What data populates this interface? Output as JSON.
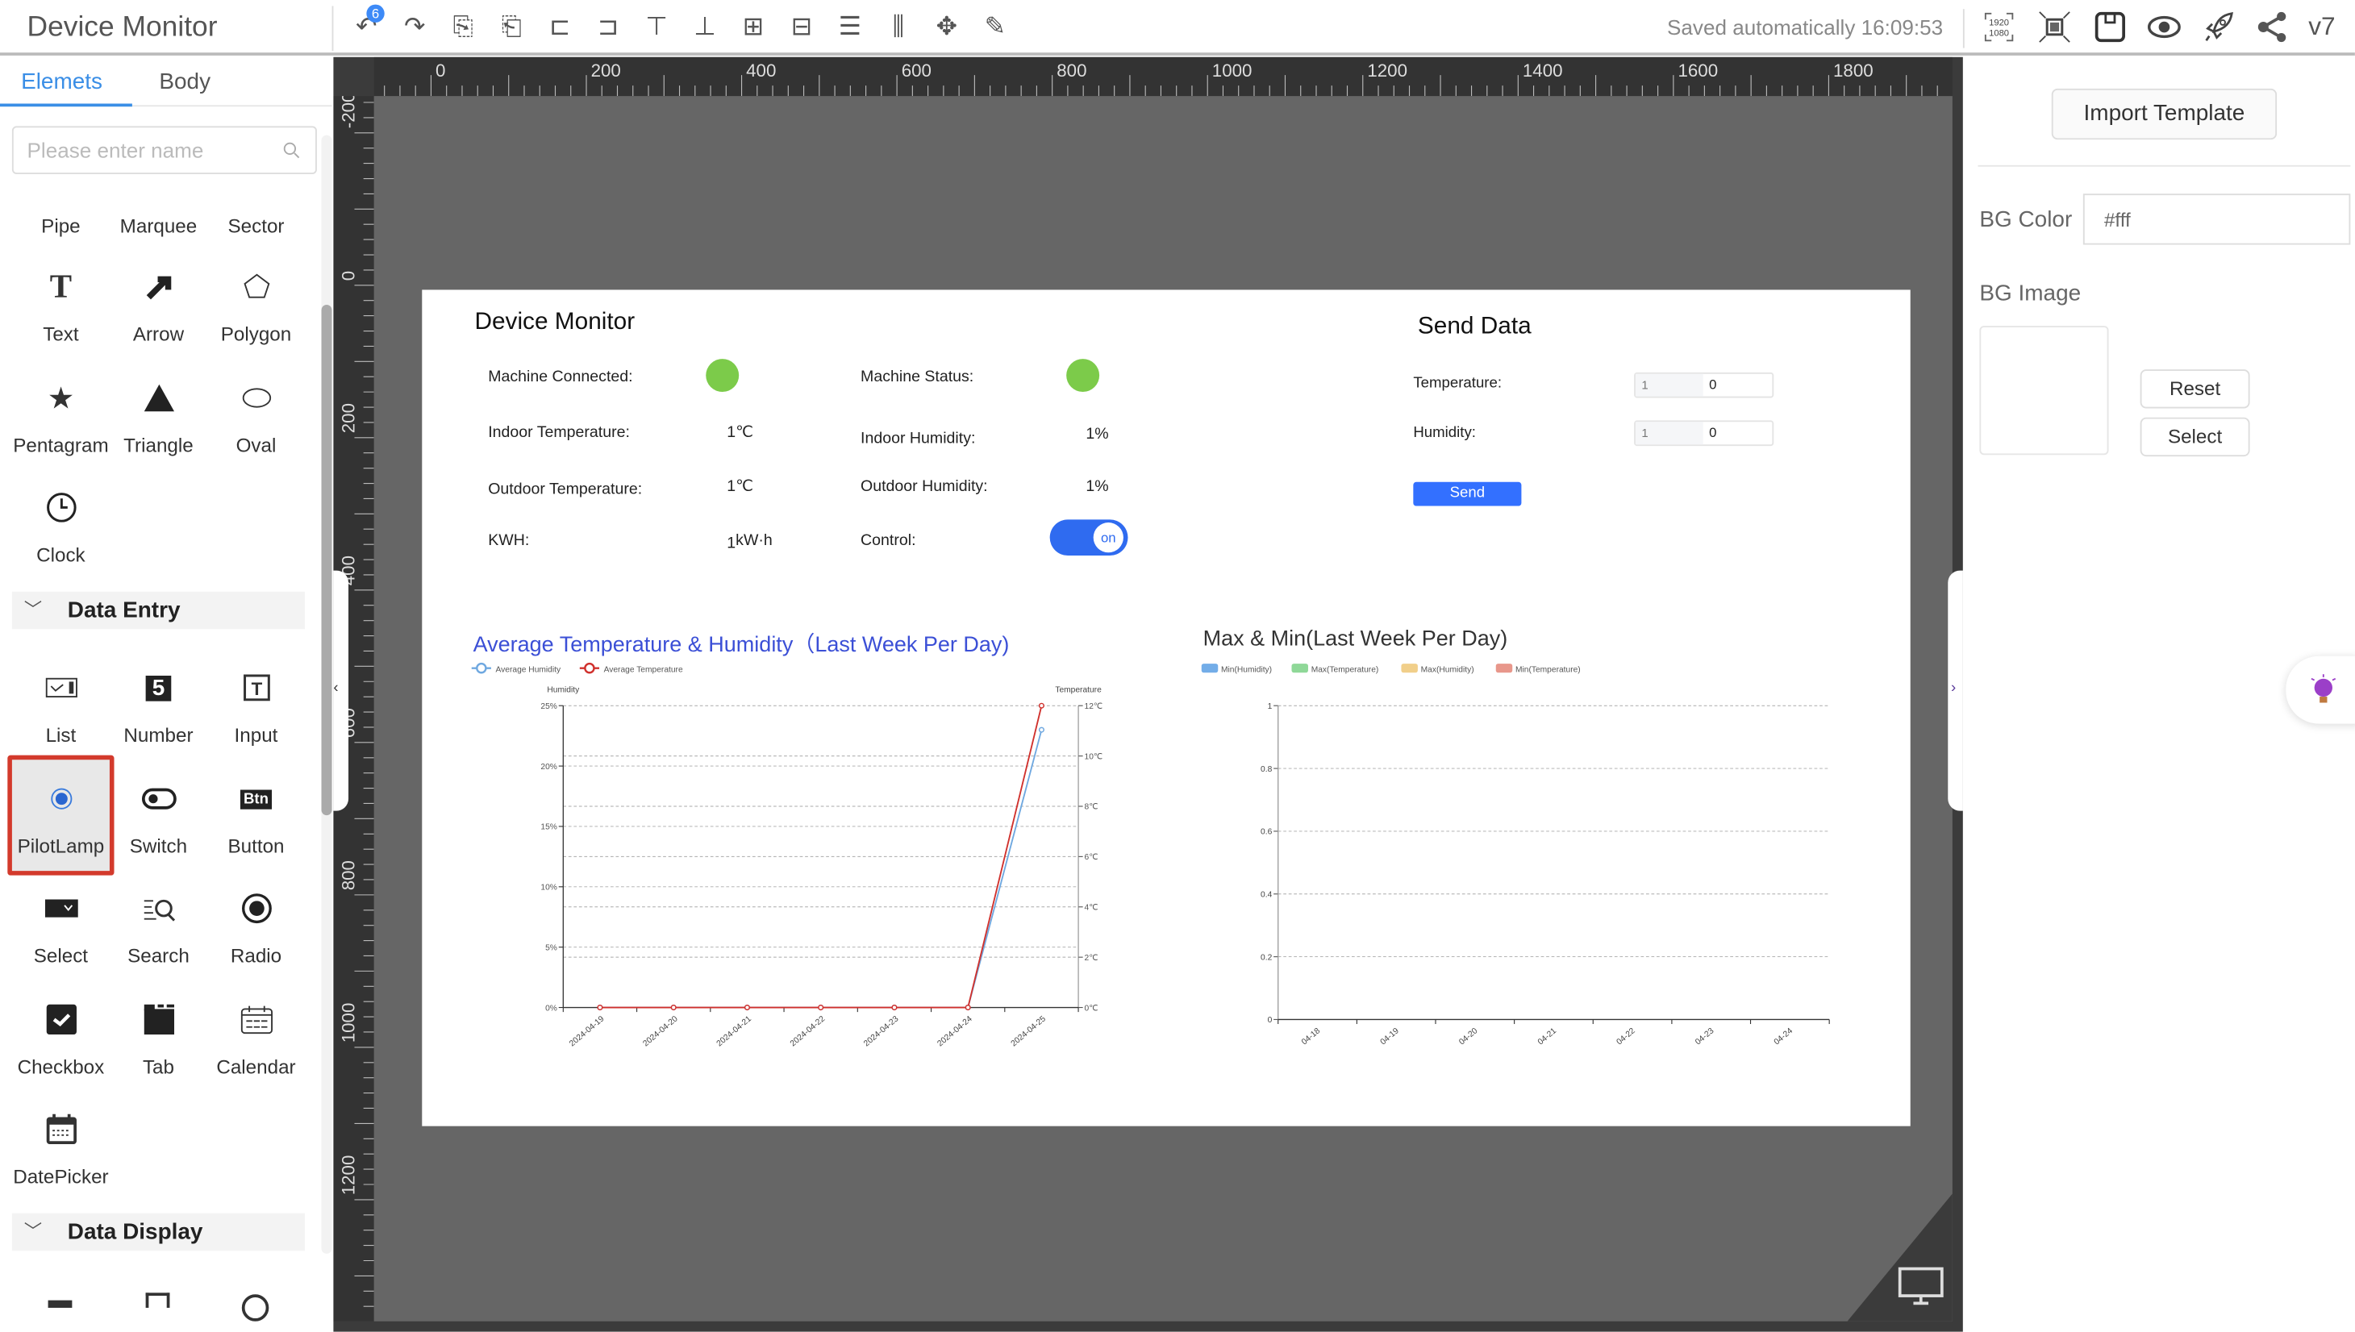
{
  "header": {
    "title": "Device Monitor",
    "undo_badge": "6",
    "saved_status": "Saved automatically 16:09:53",
    "resolution_icon": [
      "1920",
      "1080"
    ],
    "version": "v7",
    "toolbar_icons": [
      "undo-icon",
      "redo-icon",
      "copy-icon",
      "paste-icon",
      "align-left-icon",
      "align-right-icon",
      "align-top-icon",
      "align-bottom-icon",
      "align-center-horizontal-icon",
      "align-center-vertical-icon",
      "distribute-vertical-icon",
      "distribute-horizontal-icon",
      "move-icon",
      "edit-icon"
    ],
    "right_icons": [
      "resolution-icon",
      "fit-screen-icon",
      "save-icon",
      "preview-icon",
      "publish-rocket-icon",
      "share-icon"
    ]
  },
  "sidebar": {
    "tabs": [
      {
        "label": "Elemets",
        "active": true
      },
      {
        "label": "Body",
        "active": false
      }
    ],
    "search_placeholder": "Please enter name",
    "basic_items": [
      {
        "label": "Pipe",
        "icon": ""
      },
      {
        "label": "Marquee",
        "icon": ""
      },
      {
        "label": "Sector",
        "icon": ""
      },
      {
        "label": "Text",
        "icon": "text-icon"
      },
      {
        "label": "Arrow",
        "icon": "arrow-icon"
      },
      {
        "label": "Polygon",
        "icon": "polygon-icon"
      },
      {
        "label": "Pentagram",
        "icon": "star-icon"
      },
      {
        "label": "Triangle",
        "icon": "triangle-icon"
      },
      {
        "label": "Oval",
        "icon": "oval-icon"
      },
      {
        "label": "Clock",
        "icon": "clock-icon"
      }
    ],
    "groups": [
      {
        "label": "Data Entry",
        "items": [
          {
            "label": "List",
            "icon": "list-icon"
          },
          {
            "label": "Number",
            "icon": "number-icon",
            "glyph": "5"
          },
          {
            "label": "Input",
            "icon": "input-icon"
          },
          {
            "label": "PilotLamp",
            "icon": "pilot-lamp-icon",
            "selected": true
          },
          {
            "label": "Switch",
            "icon": "switch-icon"
          },
          {
            "label": "Button",
            "icon": "button-icon",
            "glyph": "Btn"
          },
          {
            "label": "Select",
            "icon": "select-icon"
          },
          {
            "label": "Search",
            "icon": "search-list-icon"
          },
          {
            "label": "Radio",
            "icon": "radio-icon"
          },
          {
            "label": "Checkbox",
            "icon": "checkbox-icon"
          },
          {
            "label": "Tab",
            "icon": "tab-icon"
          },
          {
            "label": "Calendar",
            "icon": "calendar-icon"
          },
          {
            "label": "DatePicker",
            "icon": "datepicker-icon"
          }
        ]
      },
      {
        "label": "Data Display",
        "items": []
      }
    ]
  },
  "rulers": {
    "horizontal": [
      "0",
      "200",
      "400",
      "600",
      "800",
      "1000",
      "1200",
      "1400",
      "1600",
      "1800"
    ],
    "vertical": [
      "-200",
      "0",
      "200",
      "400",
      "600",
      "800",
      "1000",
      "1200"
    ]
  },
  "board": {
    "monitor": {
      "title": "Device Monitor",
      "machine_connected_label": "Machine Connected:",
      "machine_status_label": "Machine Status:",
      "lamp_color": "#7ccb4a",
      "indoor_temp_label": "Indoor Temperature:",
      "indoor_temp_value": "1",
      "temp_unit": "℃",
      "indoor_humidity_label": "Indoor Humidity:",
      "indoor_humidity_value": "1%",
      "outdoor_temp_label": "Outdoor Temperature:",
      "outdoor_temp_value": "1℃",
      "outdoor_humidity_label": "Outdoor Humidity:",
      "outdoor_humidity_value": "1%",
      "kwh_label": "KWH:",
      "kwh_value": "1",
      "kwh_unit": "kW·h",
      "control_label": "Control:",
      "control_state": "on"
    },
    "send": {
      "title": "Send Data",
      "temperature_label": "Temperature:",
      "temperature_prefix": "1",
      "temperature_value": "0",
      "humidity_label": "Humidity:",
      "humidity_prefix": "1",
      "humidity_value": "0",
      "send_label": "Send",
      "accent": "#3370ff"
    }
  },
  "chart_data": [
    {
      "type": "line",
      "title": "Average Temperature & Humidity（Last Week Per Day)",
      "title_color": "#3b4fd6",
      "categories": [
        "2024-04-19",
        "2024-04-20",
        "2024-04-21",
        "2024-04-22",
        "2024-04-23",
        "2024-04-24",
        "2024-04-25"
      ],
      "series": [
        {
          "name": "Average Humidity",
          "axis": "left",
          "color": "#6fa8e0",
          "values": [
            0,
            0,
            0,
            0,
            0,
            0,
            23
          ]
        },
        {
          "name": "Average Temperature",
          "axis": "right",
          "color": "#d0312d",
          "values": [
            0,
            0,
            0,
            0,
            0,
            0,
            12
          ]
        }
      ],
      "ylabel_left": "Humidity",
      "ylabel_right": "Temperature",
      "ylim_left": [
        0,
        25
      ],
      "yticks_left": [
        "0%",
        "5%",
        "10%",
        "15%",
        "20%",
        "25%"
      ],
      "ylim_right": [
        0,
        12
      ],
      "yticks_right": [
        "0℃",
        "2℃",
        "4℃",
        "6℃",
        "8℃",
        "10℃",
        "12℃"
      ],
      "grid": true,
      "legend": "top-left"
    },
    {
      "type": "bar",
      "title": "Max & Min(Last Week Per Day)",
      "categories": [
        "04-18",
        "04-19",
        "04-20",
        "04-21",
        "04-22",
        "04-23",
        "04-24"
      ],
      "series": [
        {
          "name": "Min(Humidity)",
          "color": "#73ade8",
          "values": []
        },
        {
          "name": "Max(Temperature)",
          "color": "#8fd898",
          "values": []
        },
        {
          "name": "Max(Humidity)",
          "color": "#f1cf8a",
          "values": []
        },
        {
          "name": "Min(Temperature)",
          "color": "#e8978b",
          "values": []
        }
      ],
      "ylim": [
        0,
        1
      ],
      "yticks": [
        "0",
        "0.2",
        "0.4",
        "0.6",
        "0.8",
        "1"
      ],
      "grid": true,
      "legend": "top-left"
    }
  ],
  "right_panel": {
    "import_label": "Import Template",
    "bg_color_label": "BG Color",
    "bg_color_value": "#fff",
    "bg_image_label": "BG Image",
    "reset_label": "Reset",
    "select_label": "Select"
  }
}
